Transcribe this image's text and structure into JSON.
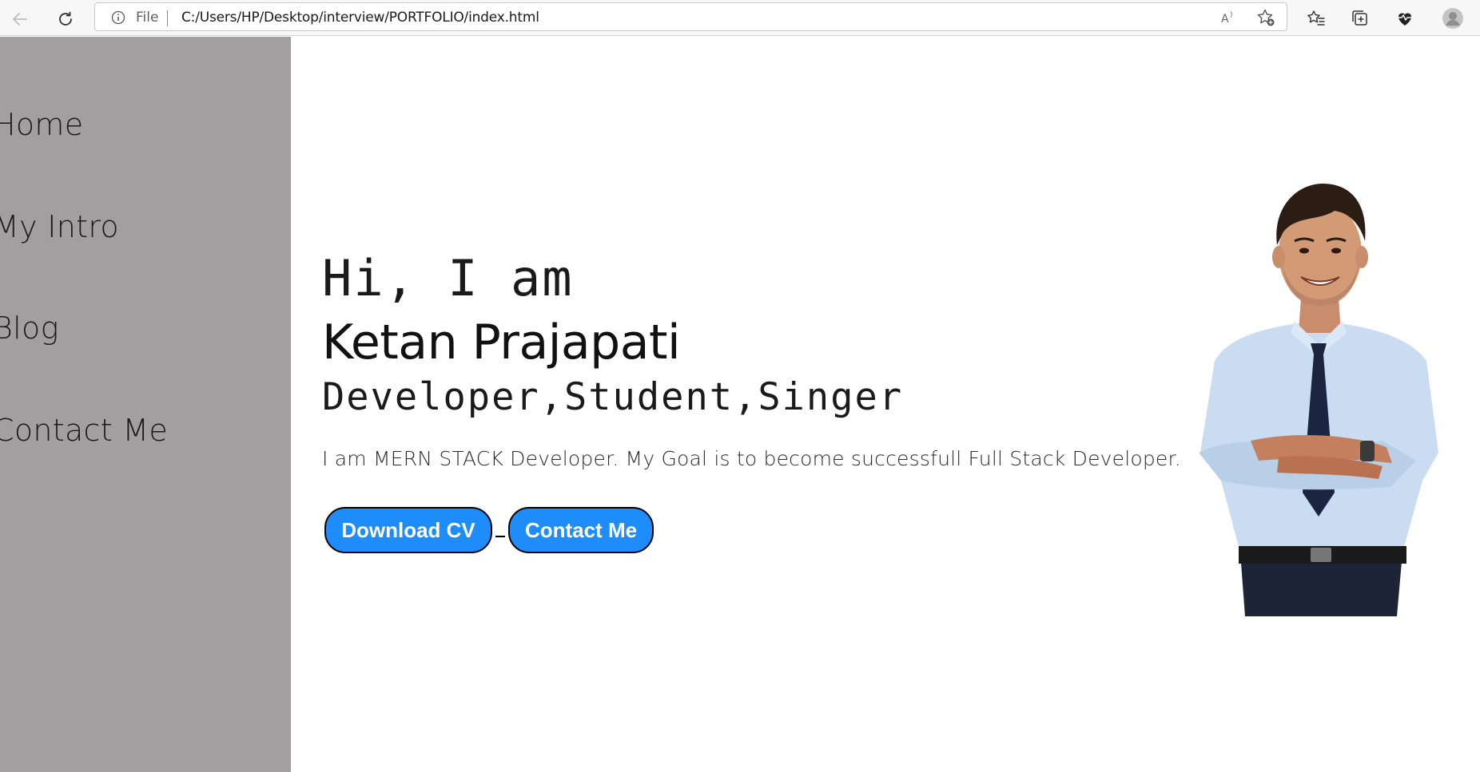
{
  "browser": {
    "protocol_label": "File",
    "url": "C:/Users/HP/Desktop/interview/PORTFOLIO/index.html",
    "icons": [
      "back-arrow-icon",
      "refresh-icon",
      "info-icon",
      "read-aloud-icon",
      "add-favorite-icon",
      "favorites-icon",
      "collections-icon",
      "browser-essentials-icon",
      "profile-icon"
    ]
  },
  "sidebar": {
    "items": [
      {
        "label": "Home"
      },
      {
        "label": "My Intro"
      },
      {
        "label": "Blog"
      },
      {
        "label": "Contact Me"
      }
    ]
  },
  "hero": {
    "greeting": "Hi, I am",
    "name": "Ketan Prajapati",
    "roles": "Developer,Student,Singer",
    "description": "I am MERN STACK Developer. My Goal is to become successfull Full Stack Developer.",
    "buttons": {
      "download_cv": "Download CV",
      "contact_me": "Contact Me"
    }
  },
  "colors": {
    "sidebar_bg": "#a19fa0",
    "button_bg": "#1e8cf9",
    "button_text": "#ffffff",
    "page_bg": "#ffffff"
  }
}
